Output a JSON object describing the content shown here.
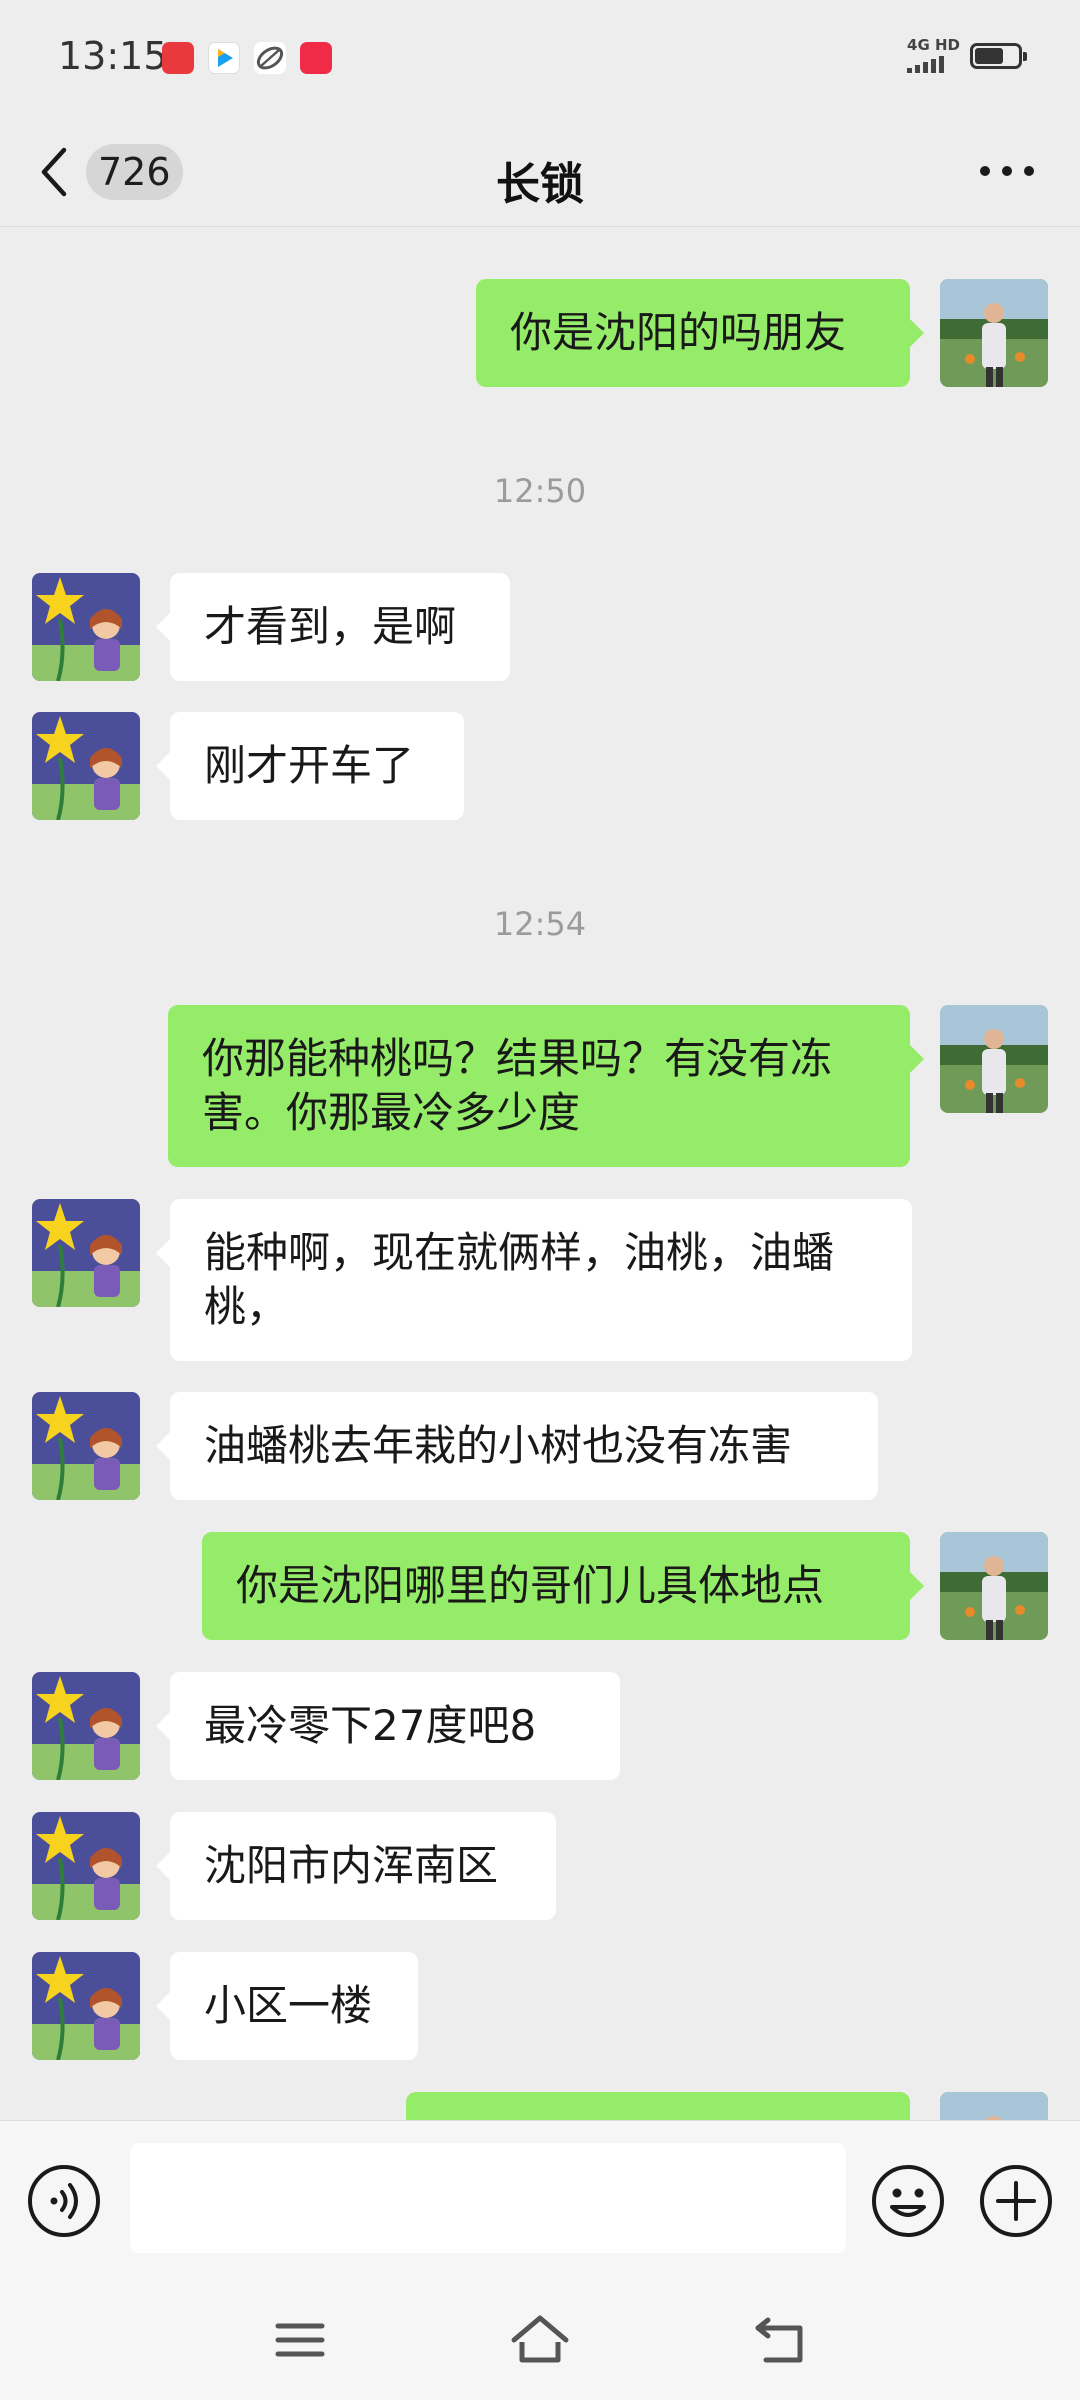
{
  "status_bar": {
    "time": "13:15",
    "network": "4G HD",
    "app_icons": [
      "gift-app-icon",
      "video-app-icon",
      "leaf-app-icon",
      "red-app-icon"
    ]
  },
  "header": {
    "unread_count": "726",
    "title": "长锁"
  },
  "messages": [
    {
      "type": "message",
      "from": "me",
      "text": "你是沈阳的吗朋友"
    },
    {
      "type": "time",
      "text": "12:50"
    },
    {
      "type": "message",
      "from": "other",
      "text": "才看到，是啊"
    },
    {
      "type": "message",
      "from": "other",
      "text": "刚才开车了"
    },
    {
      "type": "time",
      "text": "12:54"
    },
    {
      "type": "message",
      "from": "me",
      "text": "你那能种桃吗？结果吗？有没有冻害。你那最冷多少度"
    },
    {
      "type": "message",
      "from": "other",
      "text": "能种啊，现在就俩样，油桃，油蟠桃，"
    },
    {
      "type": "message",
      "from": "other",
      "text": "油蟠桃去年栽的小树也没有冻害"
    },
    {
      "type": "message",
      "from": "me",
      "text": "你是沈阳哪里的哥们儿具体地点"
    },
    {
      "type": "message",
      "from": "other",
      "text": "最冷零下27度吧8"
    },
    {
      "type": "message",
      "from": "other",
      "text": "沈阳市内浑南区"
    },
    {
      "type": "message",
      "from": "other",
      "text": "小区一楼"
    },
    {
      "type": "message",
      "from": "me",
      "text": ""
    }
  ],
  "colors": {
    "background": "#ededed",
    "outgoing_bubble": "#95ec69",
    "incoming_bubble": "#ffffff",
    "timestamp": "#9b9b9b"
  }
}
